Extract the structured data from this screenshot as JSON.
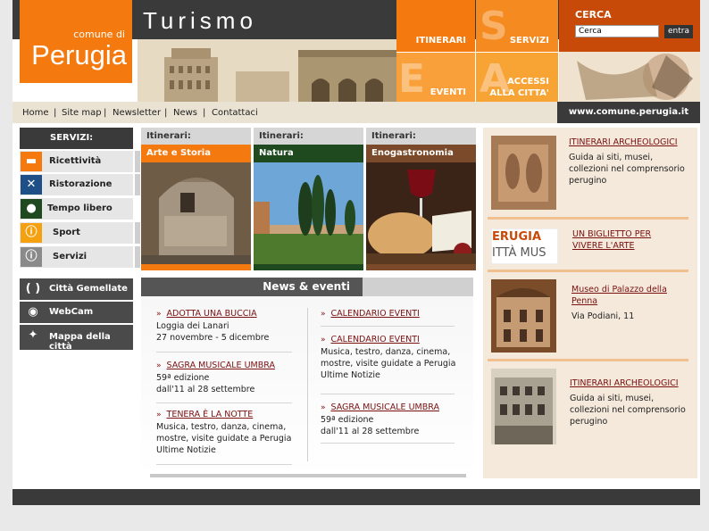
{
  "header": {
    "logo_small": "comune di",
    "logo_big": "Perugia",
    "title": "Turismo",
    "tiles": [
      "ITINERARI",
      "SERVIZI",
      "EVENTI",
      "ACCESSI\nALLA CITTA'"
    ],
    "search": {
      "label": "CERCA",
      "value": "Cerca",
      "button": "entra"
    },
    "url": "www.comune.perugia.it"
  },
  "nav": [
    "Home",
    "Site map",
    "Newsletter",
    "News",
    "Contattaci"
  ],
  "services": {
    "heading": "SERVIZI:",
    "items": [
      {
        "label": "Ricettività",
        "icon": "bed-icon",
        "color": "#f47a10"
      },
      {
        "label": "Ristorazione",
        "icon": "fork-knife-icon",
        "color": "#1e4f86"
      },
      {
        "label": "Tempo libero",
        "icon": "movie-camera-icon",
        "color": "#1f4a20"
      },
      {
        "label": "Sport",
        "icon": "info-icon",
        "color": "#f5a00e"
      },
      {
        "label": "Servizi",
        "icon": "info-icon",
        "color": "#8a8a8a"
      }
    ]
  },
  "extra_links": [
    {
      "label": "Città Gemellate",
      "icon": "parentheses-icon"
    },
    {
      "label": "WebCam",
      "icon": "eye-icon"
    },
    {
      "label": "Mappa della città",
      "icon": "compass-icon"
    }
  ],
  "itineraries": [
    {
      "prefix": "Itinerari:",
      "name": "Arte e Storia",
      "color": "#f47a10"
    },
    {
      "prefix": "Itinerari:",
      "name": "Natura",
      "color": "#1f4a20"
    },
    {
      "prefix": "Itinerari:",
      "name": "Enogastronomia",
      "color": "#7a4a2a"
    }
  ],
  "news": {
    "title": "News & eventi",
    "left": [
      {
        "title": "ADOTTA UNA BUCCIA",
        "body": [
          "Loggia dei Lanari",
          "27 novembre - 5 dicembre"
        ]
      },
      {
        "title": "SAGRA MUSICALE UMBRA",
        "body": [
          "59ª edizione",
          "dall'11 al 28 settembre"
        ]
      },
      {
        "title": "TENERA È LA NOTTE",
        "body": [
          "Musica, testro, danza, cinema,",
          "mostre, visite guidate a Perugia",
          "Ultime Notizie"
        ]
      }
    ],
    "right": [
      {
        "title": "CALENDARIO EVENTI",
        "body": []
      },
      {
        "title": "CALENDARIO EVENTI",
        "body": [
          "Musica, testro, danza, cinema,",
          "mostre, visite guidate a Perugia",
          "Ultime Notizie"
        ]
      },
      {
        "title": "SAGRA MUSICALE UMBRA",
        "body": [
          "59ª edizione",
          "dall'11 al 28 settembre"
        ]
      }
    ]
  },
  "right_column": [
    {
      "title": "ITINERARI ARCHEOLOGICI",
      "body": [
        "Guida ai siti, musei,",
        "collezioni nel comprensorio",
        "perugino"
      ]
    },
    {
      "title": "UN BIGLIETTO PER VIVERE L'ARTE",
      "body": [],
      "img_text1": "ERUGIA",
      "img_text2": "ITTÀ MUS"
    },
    {
      "title": "Museo di Palazzo della Penna",
      "body": [
        "Via Podiani, 11"
      ]
    },
    {
      "title": "ITINERARI ARCHEOLOGICI",
      "body": [
        "Guida ai siti, musei,",
        "collezioni nel comprensorio",
        "perugino"
      ]
    }
  ]
}
